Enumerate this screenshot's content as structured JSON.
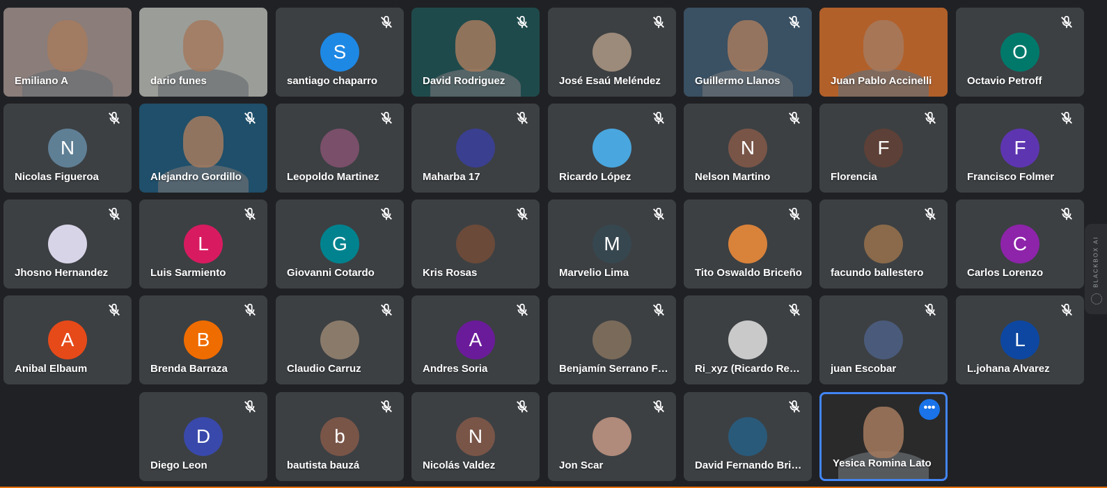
{
  "participants": [
    {
      "name": "Emiliano A",
      "kind": "video",
      "muted": false,
      "bg": "#8a7d7a"
    },
    {
      "name": "dario funes",
      "kind": "video",
      "muted": false,
      "bg": "#9b9d98"
    },
    {
      "name": "santiago chaparro",
      "kind": "initial",
      "initial": "S",
      "color": "#1e88e5",
      "muted": true
    },
    {
      "name": "David Rodriguez",
      "kind": "video",
      "muted": true,
      "bg": "#1f4a4c"
    },
    {
      "name": "José Esaú Meléndez",
      "kind": "photo",
      "muted": true,
      "color": "#9c8a7a"
    },
    {
      "name": "Guillermo Llanos",
      "kind": "video",
      "muted": true,
      "bg": "#3a5063"
    },
    {
      "name": "Juan Pablo Accinelli",
      "kind": "video",
      "muted": false,
      "bg": "#b2602a"
    },
    {
      "name": "Octavio Petroff",
      "kind": "initial",
      "initial": "O",
      "color": "#00796b",
      "muted": true
    },
    {
      "name": "Nicolas Figueroa",
      "kind": "initial",
      "initial": "N",
      "color": "#5f7f95",
      "muted": true
    },
    {
      "name": "Alejandro Gordillo",
      "kind": "video",
      "muted": true,
      "bg": "#1f4f6a"
    },
    {
      "name": "Leopoldo Martinez",
      "kind": "photo",
      "muted": true,
      "color": "#7a4f6a"
    },
    {
      "name": "Maharba 17",
      "kind": "photo",
      "muted": true,
      "color": "#3a3f8f"
    },
    {
      "name": "Ricardo López",
      "kind": "photo",
      "muted": true,
      "color": "#4aa6de"
    },
    {
      "name": "Nelson Martino",
      "kind": "initial",
      "initial": "N",
      "color": "#795548",
      "muted": true
    },
    {
      "name": "Florencia",
      "kind": "initial",
      "initial": "F",
      "color": "#5d4037",
      "muted": true
    },
    {
      "name": "Francisco Folmer",
      "kind": "initial",
      "initial": "F",
      "color": "#5e35b1",
      "muted": true
    },
    {
      "name": "Jhosno Hernandez",
      "kind": "photo",
      "muted": true,
      "color": "#d8d4e8"
    },
    {
      "name": "Luis Sarmiento",
      "kind": "initial",
      "initial": "L",
      "color": "#d81b60",
      "muted": true
    },
    {
      "name": "Giovanni Cotardo",
      "kind": "initial",
      "initial": "G",
      "color": "#00838f",
      "muted": true
    },
    {
      "name": "Kris Rosas",
      "kind": "photo",
      "muted": true,
      "color": "#6b4a3a"
    },
    {
      "name": "Marvelio Lima",
      "kind": "initial",
      "initial": "M",
      "color": "#37474f",
      "muted": true
    },
    {
      "name": "Tito Oswaldo Briceño",
      "kind": "photo",
      "muted": true,
      "color": "#d9823a"
    },
    {
      "name": "facundo ballestero",
      "kind": "photo",
      "muted": true,
      "color": "#8a6a4a"
    },
    {
      "name": "Carlos Lorenzo",
      "kind": "initial",
      "initial": "C",
      "color": "#8e24aa",
      "muted": true
    },
    {
      "name": "Anibal Elbaum",
      "kind": "initial",
      "initial": "A",
      "color": "#e64a19",
      "muted": true
    },
    {
      "name": "Brenda Barraza",
      "kind": "initial",
      "initial": "B",
      "color": "#ef6c00",
      "muted": true
    },
    {
      "name": "Claudio Carruz",
      "kind": "photo",
      "muted": true,
      "color": "#8a7a6a"
    },
    {
      "name": "Andres Soria",
      "kind": "initial",
      "initial": "A",
      "color": "#6a1b9a",
      "muted": true
    },
    {
      "name": "Benjamín Serrano Flores",
      "kind": "photo",
      "muted": true,
      "color": "#7a6a5a"
    },
    {
      "name": "Ri_xyz (Ricardo Reveles)",
      "kind": "photo",
      "muted": true,
      "color": "#c9c9c9"
    },
    {
      "name": "juan Escobar",
      "kind": "photo",
      "muted": true,
      "color": "#4a5a7a"
    },
    {
      "name": "L.johana Alvarez",
      "kind": "initial",
      "initial": "L",
      "color": "#0d47a1",
      "muted": true
    },
    {
      "name": "Diego Leon",
      "kind": "initial",
      "initial": "D",
      "color": "#3949ab",
      "muted": true
    },
    {
      "name": "bautista bauzá",
      "kind": "initial",
      "initial": "b",
      "color": "#795548",
      "muted": true
    },
    {
      "name": "Nicolás Valdez",
      "kind": "initial",
      "initial": "N",
      "color": "#795548",
      "muted": true
    },
    {
      "name": "Jon Scar",
      "kind": "photo",
      "muted": true,
      "color": "#b08a7a"
    },
    {
      "name": "David Fernando Briceño",
      "kind": "photo",
      "muted": true,
      "color": "#2a5a7a"
    },
    {
      "name": "Yesica Romina Lato",
      "kind": "video",
      "muted": false,
      "bg": "#2a2a2a",
      "selected": true
    }
  ],
  "side_panel": {
    "label": "BLACKBOX AI"
  },
  "more_button": {
    "label": "•••"
  }
}
